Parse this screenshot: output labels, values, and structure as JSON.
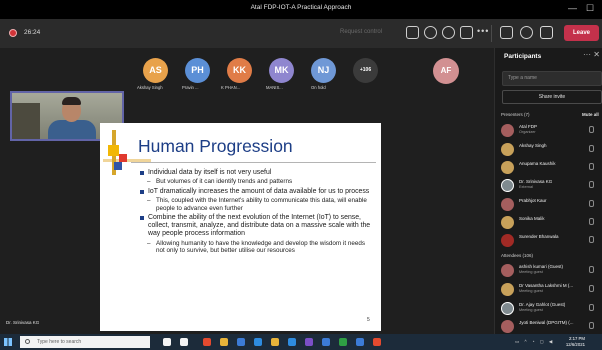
{
  "window": {
    "title": "Atal FDP-IOT-A Practical Approach",
    "minimize_glyph": "—",
    "maximize_glyph": "☐"
  },
  "toolbar": {
    "timer": "26:24",
    "request_control": "Request control",
    "more_glyph": "•••",
    "leave_label": "Leave",
    "icons": [
      "people-icon",
      "chat-icon",
      "raise-hand-icon",
      "view-icon",
      "more-icon",
      "camera-icon",
      "mic-icon",
      "share-icon"
    ]
  },
  "stage": {
    "avatars": [
      {
        "initials": "AS",
        "label": "Akshay Singh",
        "color": "#e8a24b"
      },
      {
        "initials": "PH",
        "label": "Pravin ...",
        "color": "#5b8fd6"
      },
      {
        "initials": "KK",
        "label": "K PHAN...",
        "color": "#e07c47"
      },
      {
        "initials": "MK",
        "label": "MANIS...",
        "color": "#8f86cf"
      },
      {
        "initials": "NJ",
        "label": "On hold",
        "color": "#6f98d6"
      }
    ],
    "overflow_count": "+106",
    "big_avatar": "AF",
    "presenter_name": "Dr. Srinivasa KG"
  },
  "slide": {
    "title": "Human Progression",
    "bullets": [
      {
        "text": "Individual data by itself is not very useful",
        "subs": [
          "But volumes of it can identify trends and patterns"
        ]
      },
      {
        "text": "IoT dramatically increases the amount of data available for us to process",
        "subs": [
          "This, coupled with the Internet's ability to communicate this data, will enable people to advance even further"
        ]
      },
      {
        "text": "Combine the ability of the next evolution of the Internet (IoT) to sense, collect, transmit, analyze, and distribute data on a massive scale with the way people process information",
        "subs": [
          "Allowing humanity to have the knowledge and develop the wisdom it needs not only to survive, but better utilise our resources"
        ]
      }
    ],
    "page_number": "5"
  },
  "panel": {
    "title": "Participants",
    "search_placeholder": "Type a name",
    "share_invite": "Share invite",
    "presenters_label": "Presenters (7)",
    "mute_all": "Mute all",
    "presenters": [
      {
        "name": "Atal FDP",
        "role": "Organizer"
      },
      {
        "name": "Akshay Singh",
        "role": ""
      },
      {
        "name": "Anupama Kaushik",
        "role": ""
      },
      {
        "name": "Dr. Srinivasa KG",
        "role": "External"
      },
      {
        "name": "Prabhjot Kaur",
        "role": ""
      },
      {
        "name": "Sonika Malik",
        "role": ""
      },
      {
        "name": "Surender Bhanwala",
        "role": ""
      }
    ],
    "attendees_label": "Attendees (106)",
    "attendees": [
      {
        "name": "ashish kumari (Guest)",
        "role": "Meeting guest"
      },
      {
        "name": "Dr Vasantha Lakshmi M (...",
        "role": "Meeting guest"
      },
      {
        "name": "Dr. Ajay Gahlot (Guest)",
        "role": "Meeting guest"
      },
      {
        "name": "Jyoti Beniwal (DPGITM) (...",
        "role": ""
      }
    ]
  },
  "taskbar": {
    "search_placeholder": "Type here to search",
    "time": "2:17 PM",
    "date": "12/6/2021",
    "apps": [
      "#f4f4f4",
      "#f4f4f4",
      "#e34a2f",
      "#e8b43a",
      "#3c7bd6",
      "#2e8ce0",
      "#e8b43a",
      "#2e8ce0",
      "#7b4fc7",
      "#3c7bd6",
      "#2f9e44",
      "#3c7bd6",
      "#e34a2f"
    ]
  },
  "accent_color": "#6264a7",
  "leave_color": "#c4314b"
}
